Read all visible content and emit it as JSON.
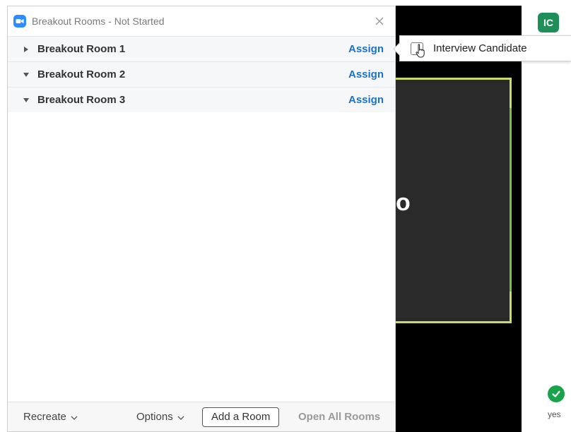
{
  "dialog": {
    "title": "Breakout Rooms - Not Started",
    "rooms": [
      {
        "name": "Breakout Room 1",
        "assign_label": "Assign"
      },
      {
        "name": "Breakout Room 2",
        "assign_label": "Assign"
      },
      {
        "name": "Breakout Room 3",
        "assign_label": "Assign"
      }
    ],
    "footer": {
      "recreate_label": "Recreate",
      "options_label": "Options",
      "add_room_label": "Add a Room",
      "open_all_label": "Open All Rooms"
    }
  },
  "popover": {
    "participant_label": "Interview Candidate",
    "checked": false
  },
  "video": {
    "visible_letter": "o"
  },
  "participant_panel": {
    "avatar_initials": "IC",
    "status_label": "yes"
  },
  "colors": {
    "accent": "#2d8cff",
    "assign_link": "#1a73c8",
    "tile_border": "#c6dd6b",
    "avatar": "#1f8f5a",
    "check": "#1aa34a"
  },
  "icons": {
    "app": "zoom-camera-icon",
    "close": "close-icon",
    "collapsed_caret": "caret-right-icon",
    "expanded_caret": "caret-down-icon",
    "chevron": "chevron-down-icon",
    "cursor": "pointer-hand-icon",
    "status": "check-circle-icon"
  }
}
